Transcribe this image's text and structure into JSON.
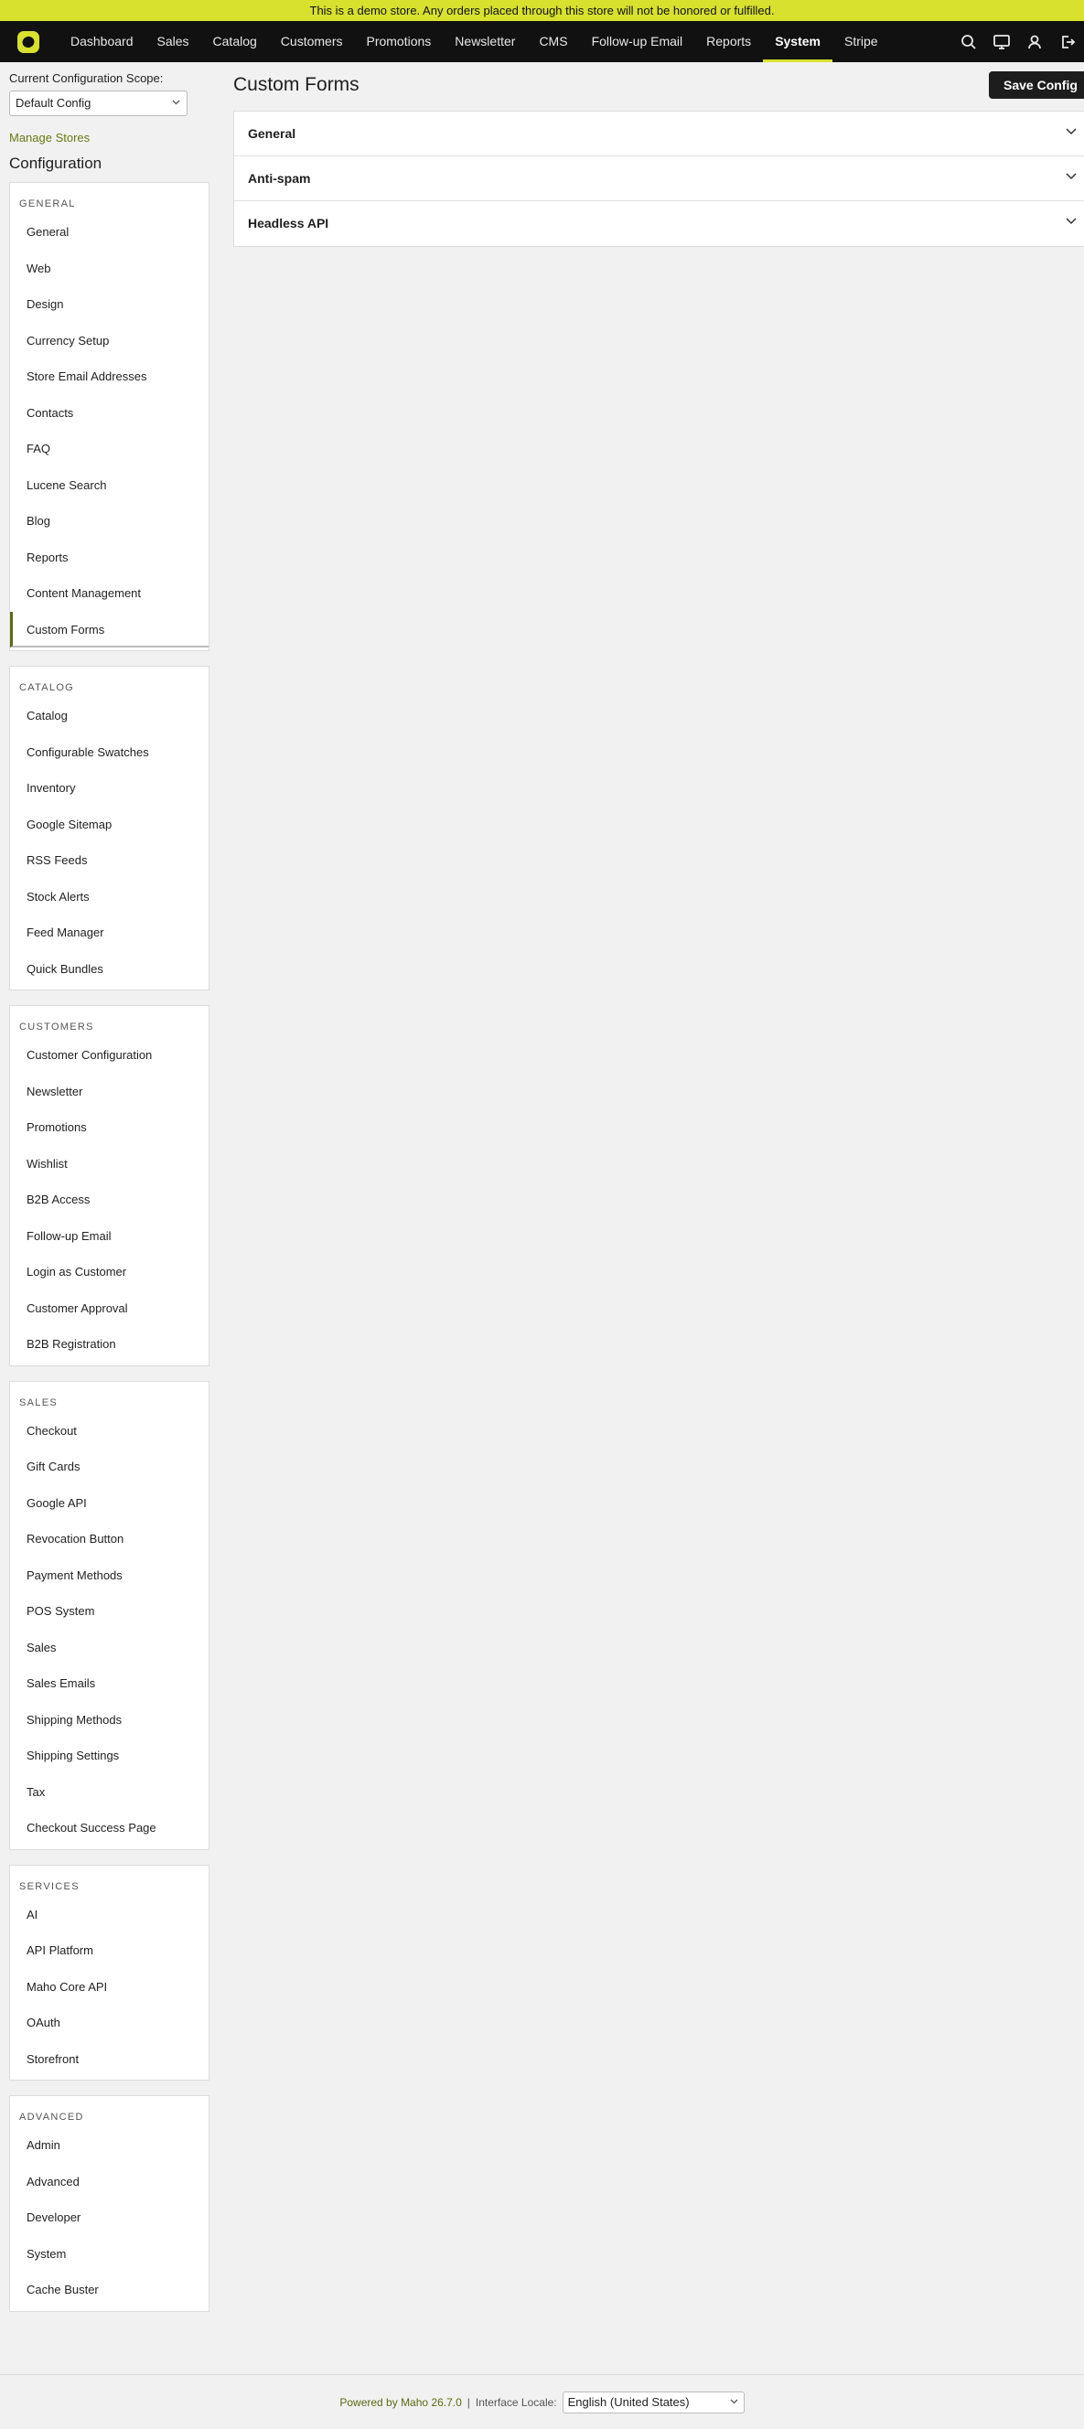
{
  "banner": {
    "text": "This is a demo store. Any orders placed through this store will not be honored or fulfilled."
  },
  "colors": {
    "accent": "#d7e12e",
    "nav_bg": "#111111",
    "link": "#6a7a12",
    "active_marker": "#5a6a12"
  },
  "topnav": {
    "logo_icon": "maho-logo-icon",
    "items": [
      {
        "label": "Dashboard"
      },
      {
        "label": "Sales"
      },
      {
        "label": "Catalog"
      },
      {
        "label": "Customers"
      },
      {
        "label": "Promotions"
      },
      {
        "label": "Newsletter"
      },
      {
        "label": "CMS"
      },
      {
        "label": "Follow-up Email"
      },
      {
        "label": "Reports"
      },
      {
        "label": "System",
        "active": true
      },
      {
        "label": "Stripe"
      }
    ],
    "icons": [
      "search-icon",
      "monitor-icon",
      "user-icon",
      "logout-icon"
    ]
  },
  "sidebar": {
    "scope_label": "Current Configuration Scope:",
    "scope_value": "Default Config",
    "manage_stores": "Manage Stores",
    "heading": "Configuration",
    "groups": [
      {
        "title": "General",
        "items": [
          "General",
          "Web",
          "Design",
          "Currency Setup",
          "Store Email Addresses",
          "Contacts",
          "FAQ",
          "Lucene Search",
          "Blog",
          "Reports",
          "Content Management",
          "Custom Forms"
        ],
        "active": "Custom Forms"
      },
      {
        "title": "Catalog",
        "items": [
          "Catalog",
          "Configurable Swatches",
          "Inventory",
          "Google Sitemap",
          "RSS Feeds",
          "Stock Alerts",
          "Feed Manager",
          "Quick Bundles"
        ]
      },
      {
        "title": "Customers",
        "items": [
          "Customer Configuration",
          "Newsletter",
          "Promotions",
          "Wishlist",
          "B2B Access",
          "Follow-up Email",
          "Login as Customer",
          "Customer Approval",
          "B2B Registration"
        ]
      },
      {
        "title": "Sales",
        "items": [
          "Checkout",
          "Gift Cards",
          "Google API",
          "Revocation Button",
          "Payment Methods",
          "POS System",
          "Sales",
          "Sales Emails",
          "Shipping Methods",
          "Shipping Settings",
          "Tax",
          "Checkout Success Page"
        ]
      },
      {
        "title": "Services",
        "items": [
          "AI",
          "API Platform",
          "Maho Core API",
          "OAuth",
          "Storefront"
        ]
      },
      {
        "title": "Advanced",
        "items": [
          "Admin",
          "Advanced",
          "Developer",
          "System",
          "Cache Buster"
        ]
      }
    ]
  },
  "main": {
    "title": "Custom Forms",
    "save_label": "Save Config",
    "sections": [
      {
        "label": "General"
      },
      {
        "label": "Anti-spam"
      },
      {
        "label": "Headless API"
      }
    ]
  },
  "footer": {
    "powered": "Powered by Maho 26.7.0",
    "separator": "|",
    "locale_label": "Interface Locale:",
    "locale_value": "English (United States)"
  }
}
